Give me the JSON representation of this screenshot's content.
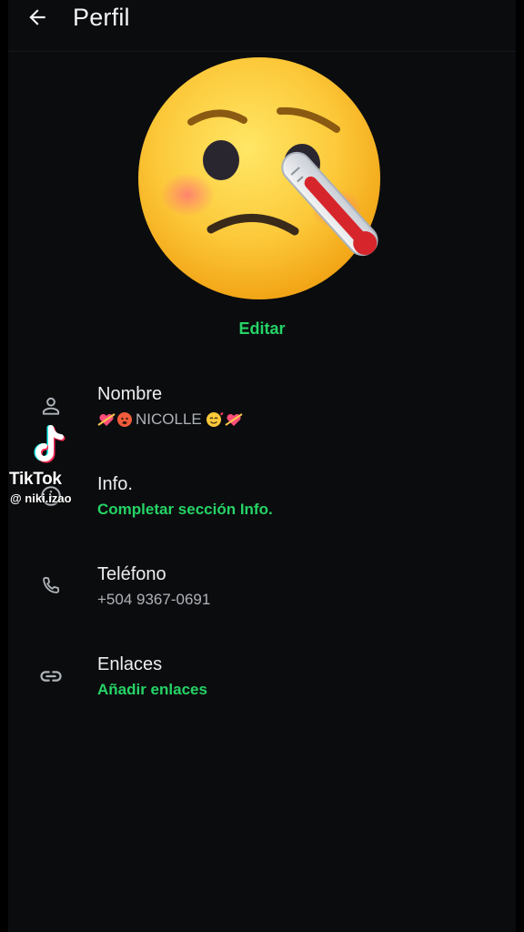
{
  "header": {
    "title": "Perfil",
    "back_icon": "arrow-left-icon"
  },
  "avatar": {
    "description_icon": "face-with-thermometer-emoji"
  },
  "edit_label": "Editar",
  "rows": [
    {
      "icon": "person-icon",
      "label": "Nombre",
      "value": "NICOLLE",
      "value_style": "gray"
    },
    {
      "icon": "info-icon",
      "label": "Info.",
      "value": "Completar sección Info.",
      "value_style": "green"
    },
    {
      "icon": "phone-icon",
      "label": "Teléfono",
      "value": "+504 9367-0691",
      "value_style": "gray"
    },
    {
      "icon": "link-icon",
      "label": "Enlaces",
      "value": "Añadir enlaces",
      "value_style": "green"
    }
  ],
  "watermark": {
    "brand": "TikTok",
    "user": "@ niki.izao"
  },
  "colors": {
    "accent": "#25d366",
    "background": "#0b0c0e",
    "text_primary": "#eeeeee",
    "text_secondary": "#aeb3b8",
    "icon": "#aeb3b8"
  }
}
